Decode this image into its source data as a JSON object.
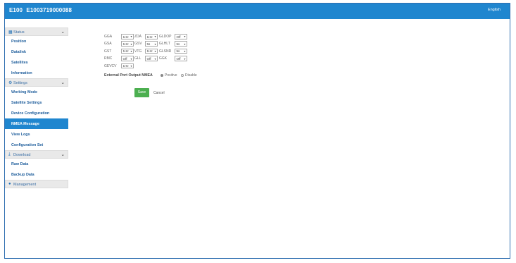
{
  "header": {
    "model": "E100",
    "serial": "E1003719000088",
    "language": "English"
  },
  "sidebar": {
    "status": {
      "label": "Status",
      "items": [
        "Position",
        "Datalink",
        "Satellites",
        "Information"
      ]
    },
    "settings": {
      "label": "Settings",
      "items": [
        "Working Mode",
        "Satellite Settings",
        "Device Configuration",
        "NMEA Message",
        "View Logs",
        "Configuration Set"
      ],
      "active": "NMEA Message"
    },
    "download": {
      "label": "Download",
      "items": [
        "Raw Data",
        "Backup Data"
      ]
    },
    "management": {
      "label": "Management"
    }
  },
  "nmea": {
    "rows": [
      [
        {
          "name": "GGA",
          "value": "1Hz"
        },
        {
          "name": "ZDA",
          "value": "1Hz"
        },
        {
          "name": "GLDOP",
          "value": "Off"
        }
      ],
      [
        {
          "name": "GSA",
          "value": "1Hz"
        },
        {
          "name": "GSV",
          "value": "5s"
        },
        {
          "name": "GLHLT",
          "value": "5s"
        }
      ],
      [
        {
          "name": "GST",
          "value": "1Hz"
        },
        {
          "name": "VTG",
          "value": "1Hz"
        },
        {
          "name": "GLSNR",
          "value": "5s"
        }
      ],
      [
        {
          "name": "RMC",
          "value": "Off"
        },
        {
          "name": "GLL",
          "value": "Off"
        },
        {
          "name": "GGK",
          "value": "Off"
        }
      ],
      [
        {
          "name": "GEVCV",
          "value": "1Hz"
        }
      ]
    ]
  },
  "external": {
    "label": "External Port Output NMEA",
    "options": [
      "Positive",
      "Disable"
    ],
    "selected": "Positive"
  },
  "actions": {
    "save": "Save",
    "cancel": "Cancel"
  }
}
